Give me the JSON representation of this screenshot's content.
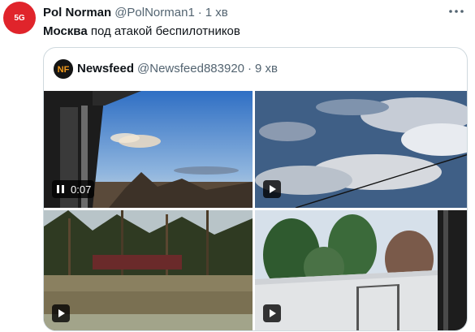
{
  "tweet": {
    "avatar_text": "5G",
    "author_name": "Pol Norman",
    "author_handle": "@PolNorman1",
    "separator": "·",
    "time": "1 хв",
    "text_bold": "Москва",
    "text_rest": " под атакой беспилотников"
  },
  "quote": {
    "author_name": "Newsfeed",
    "author_handle": "@Newsfeed883920",
    "separator": "·",
    "time": "9 хв",
    "media": [
      {
        "kind": "video",
        "state": "playing",
        "duration": "0:07"
      },
      {
        "kind": "video",
        "state": "paused"
      },
      {
        "kind": "video",
        "state": "paused"
      },
      {
        "kind": "video",
        "state": "paused"
      }
    ]
  },
  "colors": {
    "avatar_bg": "#e0242b",
    "secondary_text": "#536471",
    "border": "#cfd9de"
  }
}
